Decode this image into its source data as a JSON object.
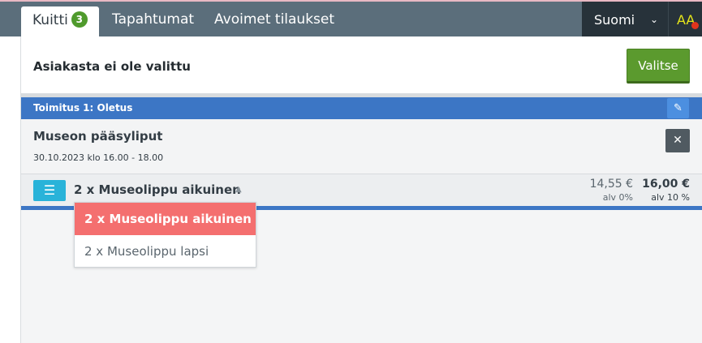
{
  "nav": {
    "tabs": [
      {
        "label": "Kuitti",
        "badge": "3"
      },
      {
        "label": "Tapahtumat"
      },
      {
        "label": "Avoimet tilaukset"
      }
    ],
    "language": {
      "label": "Suomi",
      "chevron": "⌄"
    },
    "user": {
      "initials": "AA"
    }
  },
  "customer": {
    "label": "Asiakasta ei ole valittu",
    "choose_button": "Valitse"
  },
  "delivery": {
    "label": "Toimitus 1: Oletus",
    "edit_icon": "✎"
  },
  "event": {
    "title": "Museon pääsyliput",
    "time": "30.10.2023 klo 16.00 - 18.00",
    "close_icon": "✕"
  },
  "line_item": {
    "menu_icon": "☰",
    "label": "2 x Museolippu aikuinen",
    "caret": "▲",
    "net_price": "14,55 €",
    "net_vat": "alv 0%",
    "gross_price": "16,00 €",
    "gross_vat": "alv 10 %"
  },
  "dropdown": {
    "options": [
      "2 x Museolippu aikuinen",
      "2 x Museolippu lapsi"
    ],
    "selected_index": 0
  },
  "colors": {
    "topbar": "#5b6e7b",
    "delivery_bar": "#3c76c5",
    "choose_button": "#5b9a2e",
    "selected_option": "#f46f6f",
    "badge": "#4f9a2c"
  }
}
